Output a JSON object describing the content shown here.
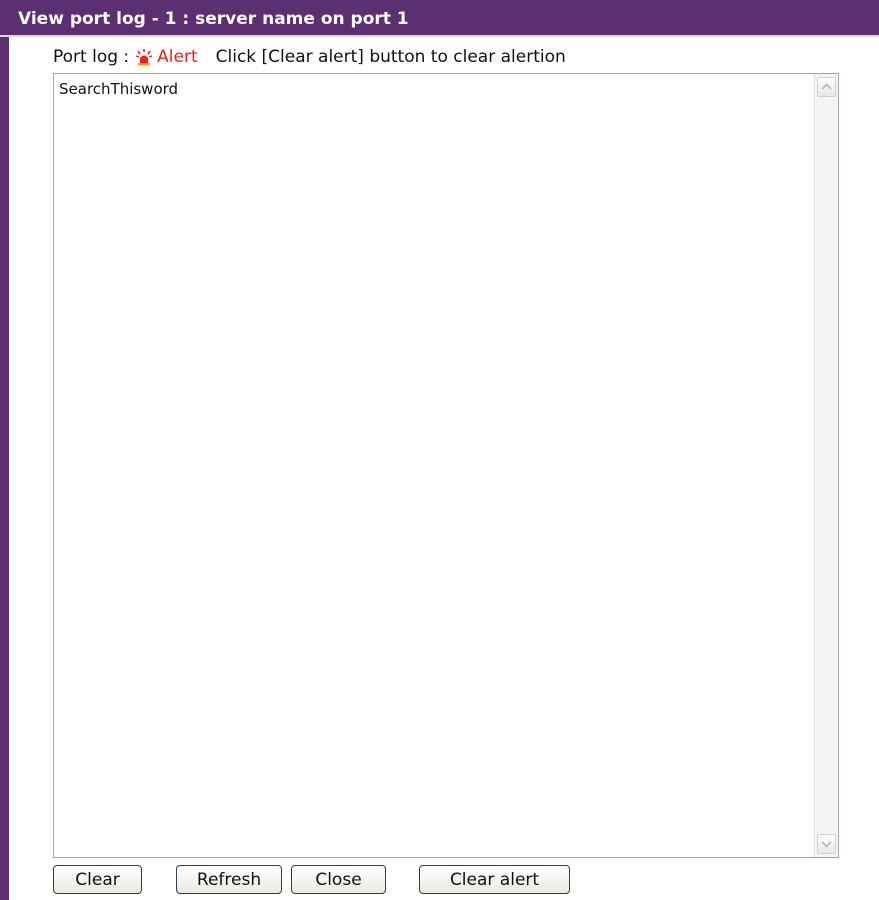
{
  "window": {
    "title": "View port log - 1 : server name on port 1"
  },
  "port_log": {
    "label": "Port log :",
    "alert_label": "Alert",
    "alert_color": "#ff1a1a",
    "hint": "Click [Clear alert] button to clear alertion",
    "content": "SearchThisword"
  },
  "buttons": {
    "clear": "Clear",
    "refresh": "Refresh",
    "close": "Close",
    "clear_alert": "Clear alert"
  },
  "colors": {
    "titlebar": "#5b2f72",
    "button_border": "#2c3e5a"
  }
}
